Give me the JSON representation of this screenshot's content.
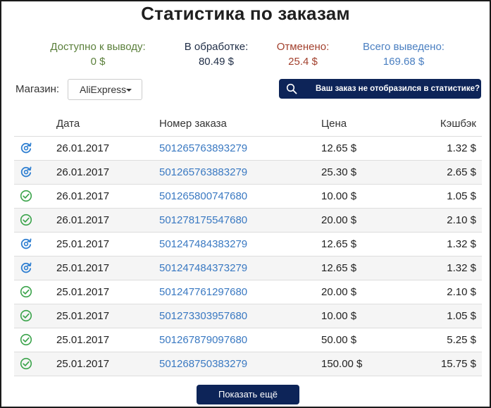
{
  "title": "Статистика по заказам",
  "stats": {
    "available": {
      "label": "Доступно к выводу:",
      "value": "0 $"
    },
    "processing": {
      "label": "В обработке:",
      "value": "80.49 $"
    },
    "cancelled": {
      "label": "Отменено:",
      "value": "25.4 $"
    },
    "withdrawn": {
      "label": "Всего выведено:",
      "value": "169.68 $"
    }
  },
  "store": {
    "label": "Магазин:",
    "selected": "AliExpress"
  },
  "help_button": {
    "label": "Ваш заказ не отобразился в статистике?"
  },
  "table": {
    "columns": [
      "Дата",
      "Номер заказа",
      "Цена",
      "Кэшбэк"
    ],
    "rows": [
      {
        "status": "processing",
        "date": "26.01.2017",
        "order": "501265763893279",
        "price": "12.65 $",
        "cashback": "1.32 $"
      },
      {
        "status": "processing",
        "date": "26.01.2017",
        "order": "501265763883279",
        "price": "25.30 $",
        "cashback": "2.65 $"
      },
      {
        "status": "confirmed",
        "date": "26.01.2017",
        "order": "501265800747680",
        "price": "10.00 $",
        "cashback": "1.05 $"
      },
      {
        "status": "confirmed",
        "date": "26.01.2017",
        "order": "501278175547680",
        "price": "20.00 $",
        "cashback": "2.10 $"
      },
      {
        "status": "processing",
        "date": "25.01.2017",
        "order": "501247484383279",
        "price": "12.65 $",
        "cashback": "1.32 $"
      },
      {
        "status": "processing",
        "date": "25.01.2017",
        "order": "501247484373279",
        "price": "12.65 $",
        "cashback": "1.32 $"
      },
      {
        "status": "confirmed",
        "date": "25.01.2017",
        "order": "501247761297680",
        "price": "20.00 $",
        "cashback": "2.10 $"
      },
      {
        "status": "confirmed",
        "date": "25.01.2017",
        "order": "501273303957680",
        "price": "10.00 $",
        "cashback": "1.05 $"
      },
      {
        "status": "confirmed",
        "date": "25.01.2017",
        "order": "501267879097680",
        "price": "50.00 $",
        "cashback": "5.25 $"
      },
      {
        "status": "confirmed",
        "date": "25.01.2017",
        "order": "501268750383279",
        "price": "150.00 $",
        "cashback": "15.75 $"
      }
    ]
  },
  "more_button": {
    "label": "Показать ещё"
  },
  "colors": {
    "available": "#5a7f3a",
    "processing": "#1f2d46",
    "cancelled": "#a2402d",
    "withdrawn": "#4a7fc1",
    "link": "#3a79c2",
    "cashback": "#d0343f",
    "button": "#0d2458",
    "status_processing_icon": "#2f7fd1",
    "status_confirmed_icon": "#3aa34a"
  },
  "icons": {
    "processing": "refresh-icon",
    "confirmed": "check-circle-icon",
    "search": "search-icon"
  }
}
